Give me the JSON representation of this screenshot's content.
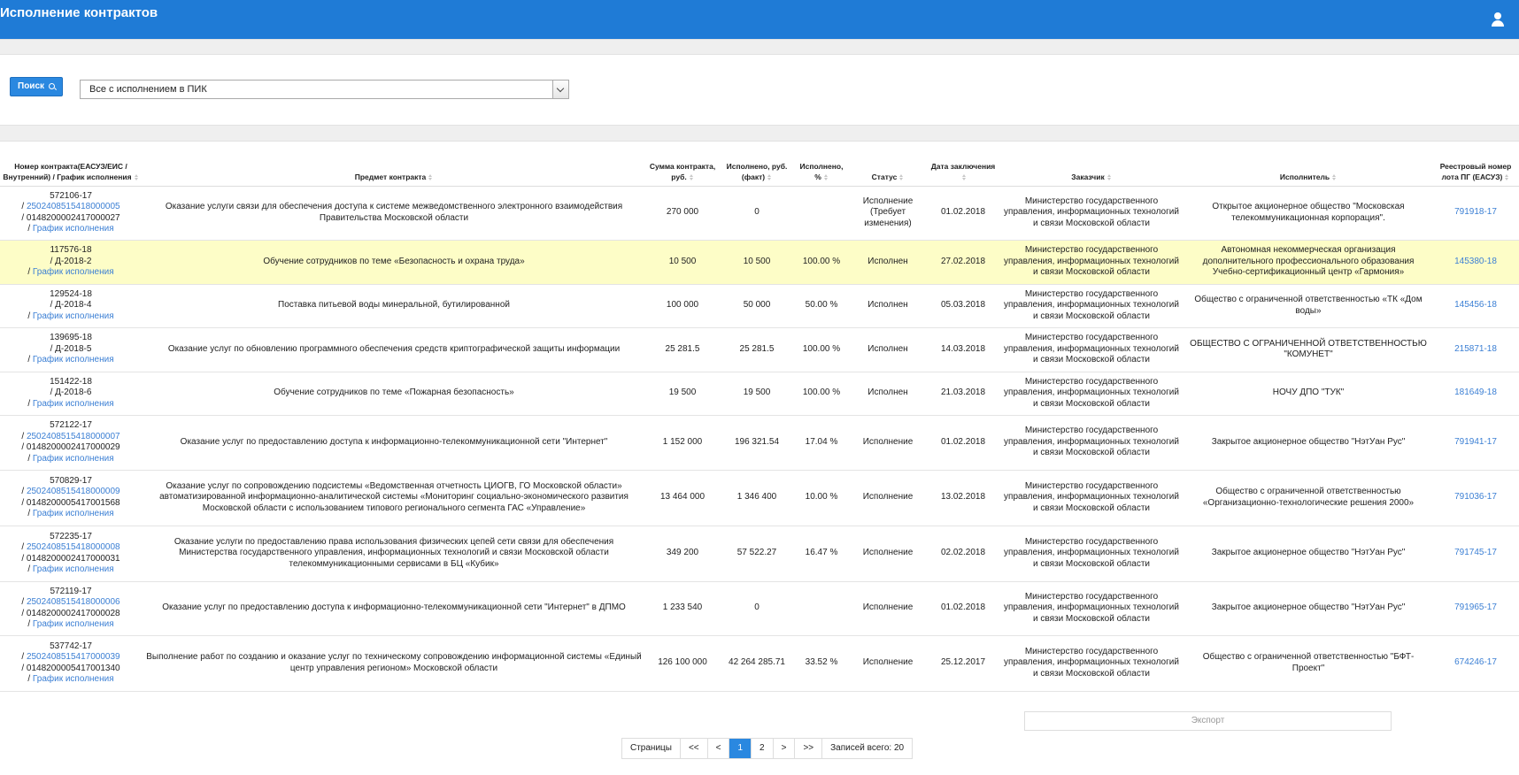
{
  "header": {
    "title": "Исполнение контрактов",
    "user_icon": "user-icon"
  },
  "toolbar": {
    "search_label": "Поиск",
    "filter_value": "Все с исполнением в ПИК"
  },
  "columns": {
    "contract_no": "Номер контракта(ЕАСУЗ/ЕИС /Внутренний) / График исполнения",
    "subject": "Предмет контракта",
    "sum": "Сумма контракта, руб.",
    "done_rub": "Исполнено, руб. (факт)",
    "done_pct": "Исполнено, %",
    "status": "Статус",
    "date": "Дата заключения",
    "customer": "Заказчик",
    "executor": "Исполнитель",
    "lot": "Реестровый номер лота ПГ (ЕАСУЗ)"
  },
  "rows": [
    {
      "id1": "572106-17",
      "id2": "2502408515418000005",
      "id3": "/ 0148200002417000027",
      "schedule": "График исполнения",
      "subject": "Оказание услуги связи для обеспечения доступа к системе межведомственного электронного взаимодействия Правительства Московской области",
      "sum": "270 000",
      "done_rub": "0",
      "done_pct": "",
      "status": "Исполнение (Требует изменения)",
      "date": "01.02.2018",
      "customer": "Министерство государственного управления, информационных технологий и связи Московской области",
      "executor": "Открытое акционерное общество \"Московская телекоммуникационная корпорация\".",
      "lot": "791918-17"
    },
    {
      "id1": "117576-18",
      "id2": "",
      "id3": "/ Д-2018-2",
      "schedule": "График исполнения",
      "subject": "Обучение сотрудников по теме «Безопасность и охрана труда»",
      "sum": "10 500",
      "done_rub": "10 500",
      "done_pct": "100.00 %",
      "status": "Исполнен",
      "date": "27.02.2018",
      "customer": "Министерство государственного управления, информационных технологий и связи Московской области",
      "executor": "Автономная некоммерческая организация дополнительного профессионального образования Учебно-сертификационный центр «Гармония»",
      "lot": "145380-18"
    },
    {
      "id1": "129524-18",
      "id2": "",
      "id3": "/ Д-2018-4",
      "schedule": "График исполнения",
      "subject": "Поставка питьевой воды минеральной, бутилированной",
      "sum": "100 000",
      "done_rub": "50 000",
      "done_pct": "50.00 %",
      "status": "Исполнен",
      "date": "05.03.2018",
      "customer": "Министерство государственного управления, информационных технологий и связи Московской области",
      "executor": "Общество с ограниченной ответственностью «ТК «Дом воды»",
      "lot": "145456-18"
    },
    {
      "id1": "139695-18",
      "id2": "",
      "id3": "/ Д-2018-5",
      "schedule": "График исполнения",
      "subject": "Оказание услуг по обновлению программного обеспечения средств криптографической защиты информации",
      "sum": "25 281.5",
      "done_rub": "25 281.5",
      "done_pct": "100.00 %",
      "status": "Исполнен",
      "date": "14.03.2018",
      "customer": "Министерство государственного управления, информационных технологий и связи Московской области",
      "executor": "ОБЩЕСТВО С ОГРАНИЧЕННОЙ ОТВЕТСТВЕННОСТЬЮ \"КОМУНЕТ\"",
      "lot": "215871-18"
    },
    {
      "id1": "151422-18",
      "id2": "",
      "id3": "/ Д-2018-6",
      "schedule": "График исполнения",
      "subject": "Обучение сотрудников по теме «Пожарная безопасность»",
      "sum": "19 500",
      "done_rub": "19 500",
      "done_pct": "100.00 %",
      "status": "Исполнен",
      "date": "21.03.2018",
      "customer": "Министерство государственного управления, информационных технологий и связи Московской области",
      "executor": "НОЧУ ДПО \"ТУК\"",
      "lot": "181649-18"
    },
    {
      "id1": "572122-17",
      "id2": "2502408515418000007",
      "id3": "/ 0148200002417000029",
      "schedule": "График исполнения",
      "subject": "Оказание услуг по предоставлению доступа к информационно-телекоммуникационной сети \"Интернет\"",
      "sum": "1 152 000",
      "done_rub": "196 321.54",
      "done_pct": "17.04 %",
      "status": "Исполнение",
      "date": "01.02.2018",
      "customer": "Министерство государственного управления, информационных технологий и связи Московской области",
      "executor": "Закрытое акционерное общество \"НэтУан Рус\"",
      "lot": "791941-17"
    },
    {
      "id1": "570829-17",
      "id2": "2502408515418000009",
      "id3": "/ 0148200005417001568",
      "schedule": "График исполнения",
      "subject": "Оказание услуг по сопровождению подсистемы «Ведомственная отчетность ЦИОГВ, ГО Московской области» автоматизированной информационно-аналитической системы «Мониторинг социально-экономического развития Московской области с использованием типового регионального сегмента ГАС «Управление»",
      "sum": "13 464 000",
      "done_rub": "1 346 400",
      "done_pct": "10.00 %",
      "status": "Исполнение",
      "date": "13.02.2018",
      "customer": "Министерство государственного управления, информационных технологий и связи Московской области",
      "executor": "Общество с ограниченной ответственностью «Организационно-технологические решения 2000»",
      "lot": "791036-17"
    },
    {
      "id1": "572235-17",
      "id2": "2502408515418000008",
      "id3": "/ 0148200002417000031",
      "schedule": "График исполнения",
      "subject": "Оказание услуги по предоставлению права использования физических цепей сети связи для обеспечения Министерства государственного управления, информационных технологий и связи Московской области телекоммуникационными сервисами в БЦ «Кубик»",
      "sum": "349 200",
      "done_rub": "57 522.27",
      "done_pct": "16.47 %",
      "status": "Исполнение",
      "date": "02.02.2018",
      "customer": "Министерство государственного управления, информационных технологий и связи Московской области",
      "executor": "Закрытое акционерное общество \"НэтУан Рус\"",
      "lot": "791745-17"
    },
    {
      "id1": "572119-17",
      "id2": "2502408515418000006",
      "id3": "/ 0148200002417000028",
      "schedule": "График исполнения",
      "subject": "Оказание услуг по предоставлению доступа к информационно-телекоммуникационной сети \"Интернет\" в ДПМО",
      "sum": "1 233 540",
      "done_rub": "0",
      "done_pct": "",
      "status": "Исполнение",
      "date": "01.02.2018",
      "customer": "Министерство государственного управления, информационных технологий и связи Московской области",
      "executor": "Закрытое акционерное общество \"НэтУан Рус\"",
      "lot": "791965-17"
    },
    {
      "id1": "537742-17",
      "id2": "2502408515417000039",
      "id3": "/ 0148200005417001340",
      "schedule": "График исполнения",
      "subject": "Выполнение работ по созданию и оказание услуг по техническому сопровождению информационной системы «Единый центр управления регионом» Московской области",
      "sum": "126 100 000",
      "done_rub": "42 264 285.71",
      "done_pct": "33.52 %",
      "status": "Исполнение",
      "date": "25.12.2017",
      "customer": "Министерство государственного управления, информационных технологий и связи Московской области",
      "executor": "Общество с ограниченной ответственностью \"БФТ-Проект\"",
      "lot": "674246-17"
    }
  ],
  "export_label": "Экспорт",
  "pager": {
    "pages_label": "Страницы",
    "first": "<<",
    "prev": "<",
    "page1": "1",
    "page2": "2",
    "next": ">",
    "last": ">>",
    "total": "Записей всего: 20"
  }
}
